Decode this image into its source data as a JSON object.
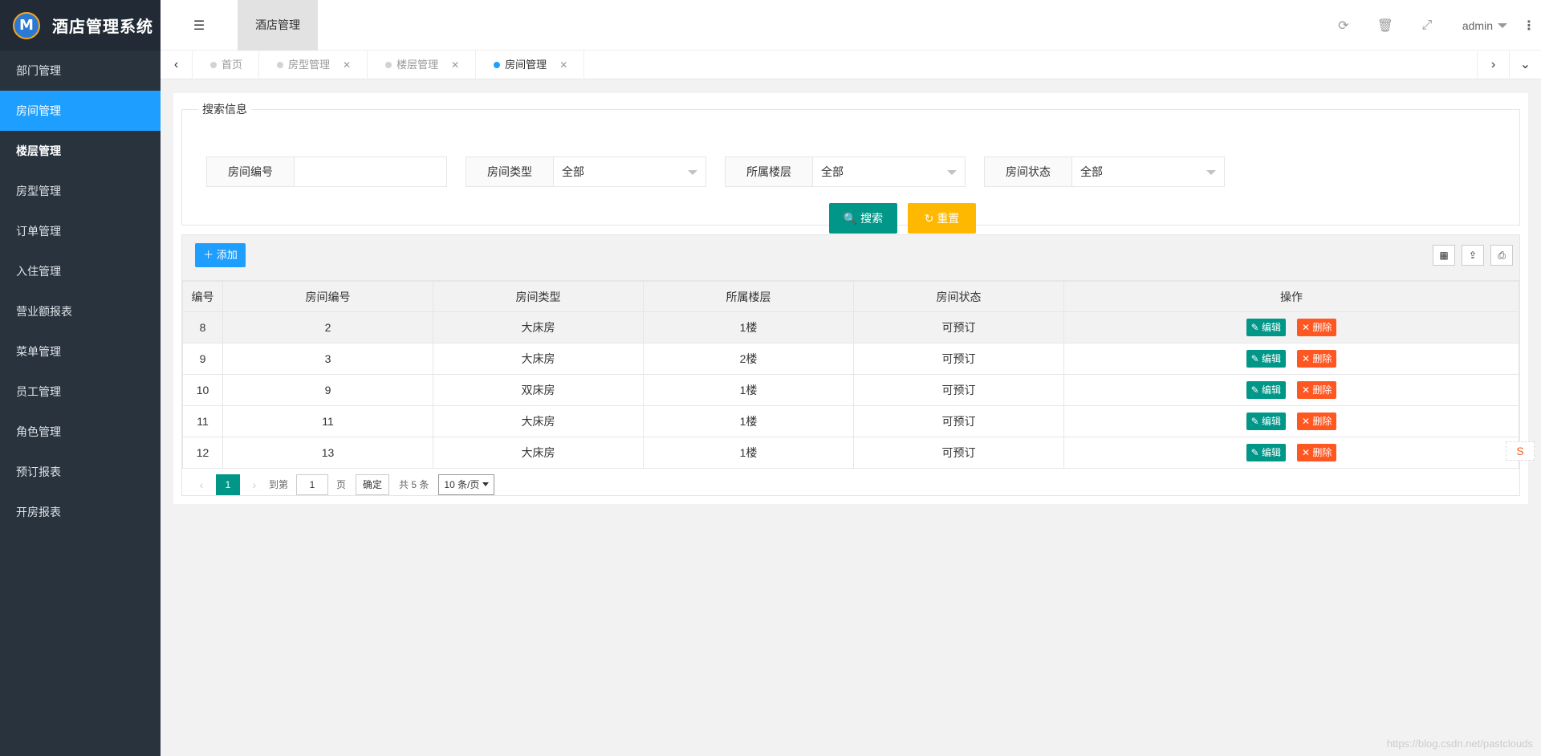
{
  "app": {
    "title": "酒店管理系统",
    "logo_letter": "M"
  },
  "sidebar": {
    "items": [
      {
        "label": "部门管理"
      },
      {
        "label": "房间管理"
      },
      {
        "label": "楼层管理"
      },
      {
        "label": "房型管理"
      },
      {
        "label": "订单管理"
      },
      {
        "label": "入住管理"
      },
      {
        "label": "营业额报表"
      },
      {
        "label": "菜单管理"
      },
      {
        "label": "员工管理"
      },
      {
        "label": "角色管理"
      },
      {
        "label": "预订报表"
      },
      {
        "label": "开房报表"
      }
    ]
  },
  "header": {
    "module_tab": "酒店管理",
    "user": "admin",
    "icons": [
      "refresh-icon",
      "trash-icon",
      "fullscreen-icon"
    ]
  },
  "tabs": [
    {
      "label": "首页"
    },
    {
      "label": "房型管理"
    },
    {
      "label": "楼层管理"
    },
    {
      "label": "房间管理"
    }
  ],
  "search": {
    "legend": "搜索信息",
    "fields": [
      {
        "label": "房间编号",
        "value": ""
      },
      {
        "label": "房间类型",
        "value": "全部"
      },
      {
        "label": "所属楼层",
        "value": "全部"
      },
      {
        "label": "房间状态",
        "value": "全部"
      }
    ],
    "search_label": "搜索",
    "reset_label": "重置"
  },
  "toolbar": {
    "add_label": "添加"
  },
  "table": {
    "columns": [
      "编号",
      "房间编号",
      "房间类型",
      "所属楼层",
      "房间状态",
      "操作"
    ],
    "rows": [
      {
        "id": "8",
        "room_no": "2",
        "type": "大床房",
        "floor": "1楼",
        "status": "可预订"
      },
      {
        "id": "9",
        "room_no": "3",
        "type": "大床房",
        "floor": "2楼",
        "status": "可预订"
      },
      {
        "id": "10",
        "room_no": "9",
        "type": "双床房",
        "floor": "1楼",
        "status": "可预订"
      },
      {
        "id": "11",
        "room_no": "11",
        "type": "大床房",
        "floor": "1楼",
        "status": "可预订"
      },
      {
        "id": "12",
        "room_no": "13",
        "type": "大床房",
        "floor": "1楼",
        "status": "可预订"
      }
    ],
    "edit_label": "编辑",
    "delete_label": "删除"
  },
  "pager": {
    "current": "1",
    "goto_prefix": "到第",
    "goto_value": "1",
    "goto_suffix": "页",
    "confirm_label": "确定",
    "total_text": "共 5 条",
    "page_size": "10 条/页"
  },
  "watermark": "https://blog.csdn.net/pastclouds"
}
